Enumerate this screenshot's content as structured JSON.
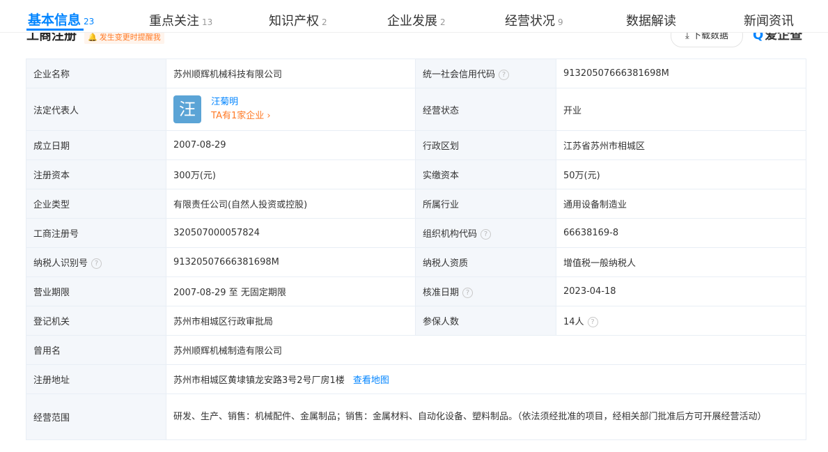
{
  "tabs": [
    {
      "label": "基本信息",
      "count": "23",
      "active": true
    },
    {
      "label": "重点关注",
      "count": "13"
    },
    {
      "label": "知识产权",
      "count": "2"
    },
    {
      "label": "企业发展",
      "count": "2"
    },
    {
      "label": "经营状况",
      "count": "9"
    },
    {
      "label": "数据解读",
      "count": ""
    },
    {
      "label": "新闻资讯",
      "count": ""
    }
  ],
  "section": {
    "title": "工商注册",
    "remind_label": "发生变更时提醒我",
    "download_label": "下载数据",
    "brand_label": "爱企查"
  },
  "rows": {
    "company_name": {
      "label": "企业名称",
      "value": "苏州顺辉机械科技有限公司"
    },
    "credit_code": {
      "label": "统一社会信用代码",
      "value": "91320507666381698M"
    },
    "legal_rep": {
      "label": "法定代表人",
      "avatar_char": "汪",
      "name": "汪菊明",
      "sub": "TA有1家企业"
    },
    "status": {
      "label": "经营状态",
      "value": "开业"
    },
    "founded": {
      "label": "成立日期",
      "value": "2007-08-29"
    },
    "region": {
      "label": "行政区划",
      "value": "江苏省苏州市相城区"
    },
    "reg_capital": {
      "label": "注册资本",
      "value": "300万(元)"
    },
    "paid_capital": {
      "label": "实缴资本",
      "value": "50万(元)"
    },
    "type": {
      "label": "企业类型",
      "value": "有限责任公司(自然人投资或控股)"
    },
    "industry": {
      "label": "所属行业",
      "value": "通用设备制造业"
    },
    "reg_no": {
      "label": "工商注册号",
      "value": "320507000057824"
    },
    "org_code": {
      "label": "组织机构代码",
      "value": "66638169-8"
    },
    "taxpayer_id": {
      "label": "纳税人识别号",
      "value": "91320507666381698M"
    },
    "taxpayer_qual": {
      "label": "纳税人资质",
      "value": "增值税一般纳税人"
    },
    "term": {
      "label": "营业期限",
      "value": "2007-08-29 至 无固定期限"
    },
    "approval_date": {
      "label": "核准日期",
      "value": "2023-04-18"
    },
    "authority": {
      "label": "登记机关",
      "value": "苏州市相城区行政审批局"
    },
    "insured": {
      "label": "参保人数",
      "value": "14人"
    },
    "former_name": {
      "label": "曾用名",
      "value": "苏州顺辉机械制造有限公司"
    },
    "address": {
      "label": "注册地址",
      "value": "苏州市相城区黄埭镇龙安路3号2号厂房1楼",
      "map_link": "查看地图"
    },
    "scope": {
      "label": "经营范围",
      "value": "研发、生产、销售：机械配件、金属制品；销售：金属材料、自动化设备、塑料制品。（依法须经批准的项目，经相关部门批准后方可开展经营活动）"
    }
  },
  "icons": {
    "help": "help-circle-icon",
    "bell": "bell-icon",
    "download": "download-icon",
    "chevron": "chevron-right-icon"
  },
  "colors": {
    "accent": "#0084ff",
    "orange": "#ff7a26",
    "key_bg": "#f4f7fb",
    "avatar": "#5ba4d6"
  }
}
